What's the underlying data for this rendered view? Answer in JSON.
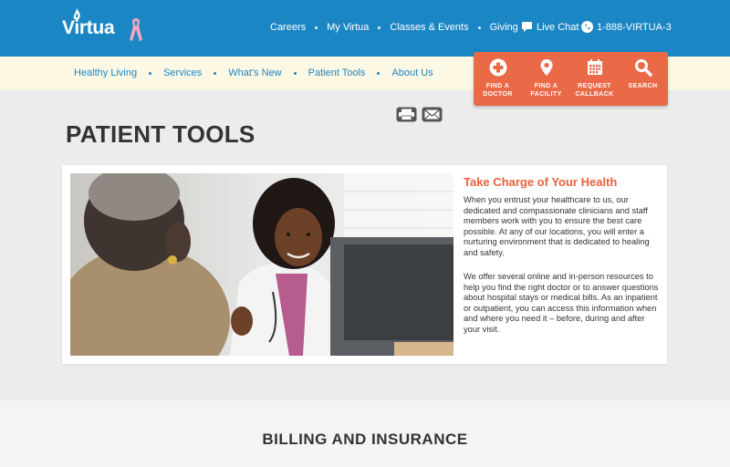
{
  "brand": {
    "name": "Virtua"
  },
  "topnav": {
    "items": [
      "Careers",
      "My Virtua",
      "Classes & Events",
      "Giving"
    ]
  },
  "chat": {
    "label": "Live Chat"
  },
  "phone": {
    "label": "1-888-VIRTUA-3"
  },
  "subnav": {
    "items": [
      "Healthy Living",
      "Services",
      "What's New",
      "Patient Tools",
      "About Us"
    ]
  },
  "quick_actions": [
    {
      "line1": "FIND A",
      "line2": "DOCTOR",
      "icon": "plus-circle-icon"
    },
    {
      "line1": "FIND A",
      "line2": "FACILITY",
      "icon": "map-pin-icon"
    },
    {
      "line1": "REQUEST",
      "line2": "CALLBACK",
      "icon": "calendar-icon"
    },
    {
      "line1": "SEARCH",
      "line2": "",
      "icon": "search-icon"
    }
  ],
  "page": {
    "title": "PATIENT TOOLS"
  },
  "card": {
    "heading": "Take Charge of Your Health",
    "p1": "When you entrust your healthcare to us, our dedicated and compassionate clinicians and staff members work with you to ensure the best care possible. At any of our locations, you will enter a nurturing environment that is dedicated to healing and safety.",
    "p2": "We offer several online and in-person resources to help you find the right doctor or to answer questions about hospital stays or medical bills. As an inpatient or outpatient, you can access this information when and where you need it – before, during and after your visit."
  },
  "section": {
    "title": "BILLING AND INSURANCE"
  },
  "colors": {
    "primary": "#1b86c4",
    "accent": "#ea6a48",
    "cream": "#fdf8e4"
  }
}
